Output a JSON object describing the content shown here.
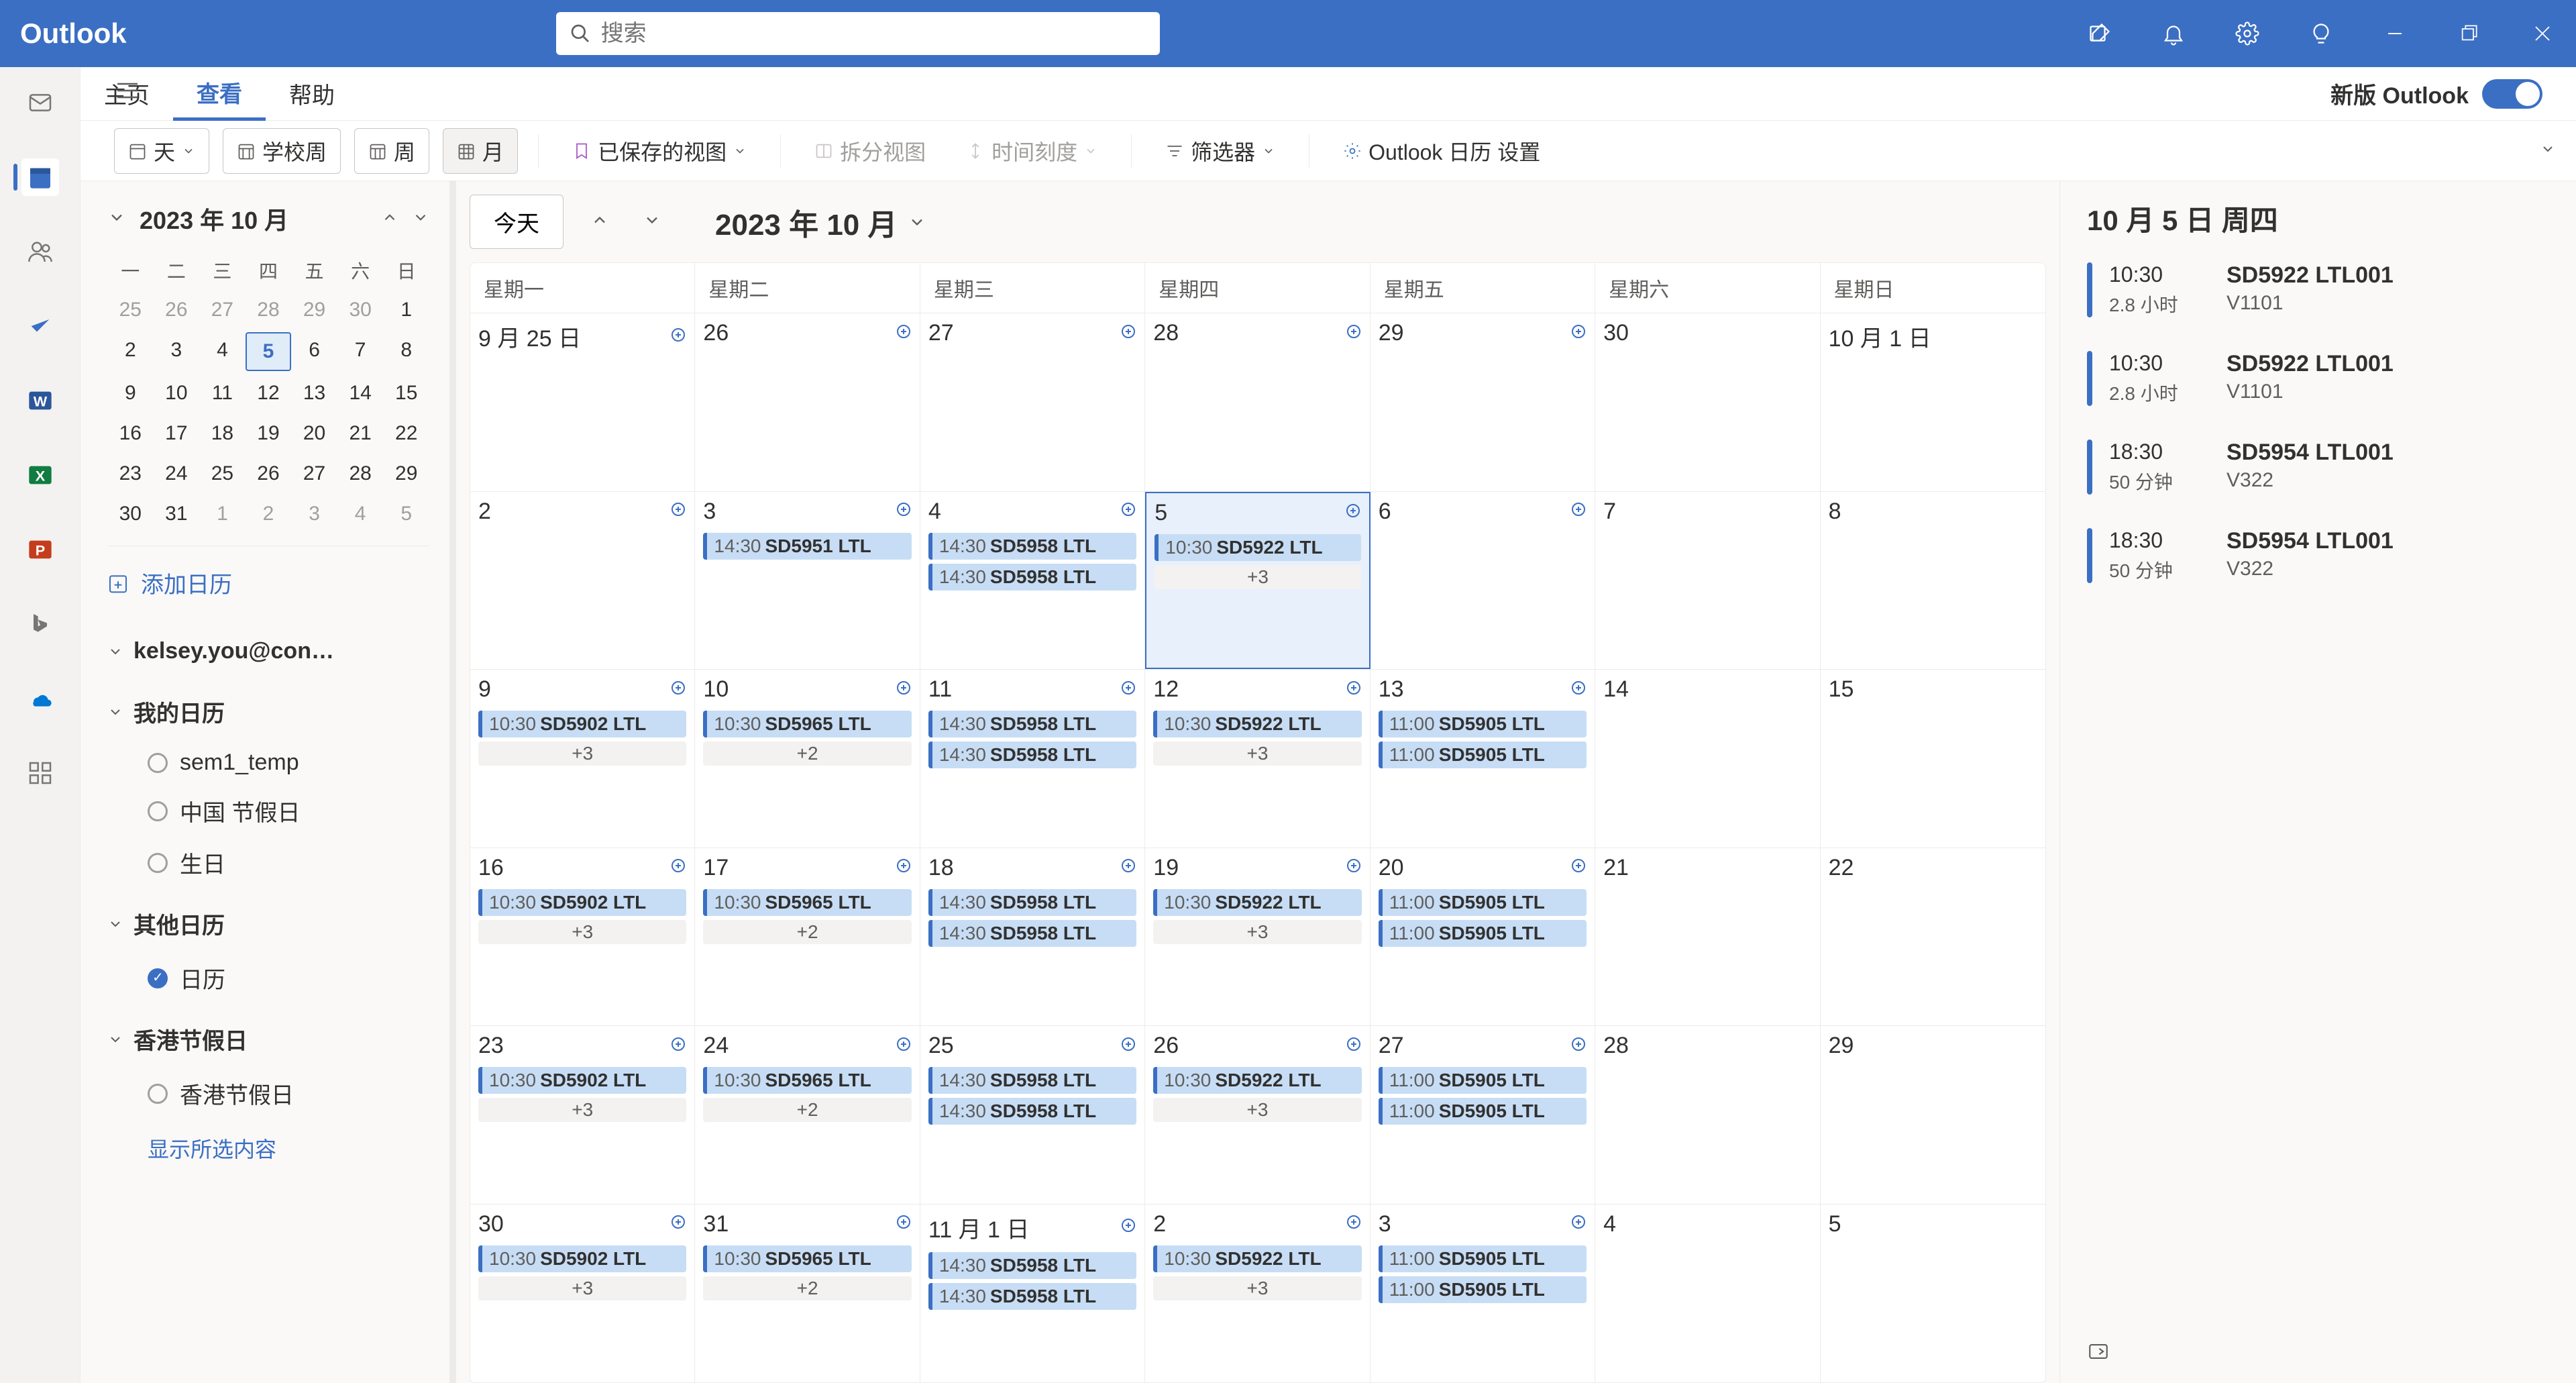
{
  "app": {
    "name": "Outlook"
  },
  "search": {
    "placeholder": "搜索"
  },
  "tabs": {
    "home": "主页",
    "view": "查看",
    "help": "帮助",
    "new_outlook": "新版 Outlook"
  },
  "ribbon": {
    "day": "天",
    "school_week": "学校周",
    "week": "周",
    "month": "月",
    "saved_views": "已保存的视图",
    "split_view": "拆分视图",
    "time_scale": "时间刻度",
    "filter": "筛选器",
    "settings": "Outlook 日历 设置"
  },
  "mini": {
    "label": "2023 年 10 月",
    "dow": [
      "一",
      "二",
      "三",
      "四",
      "五",
      "六",
      "日"
    ],
    "rows": [
      [
        {
          "d": "25",
          "o": true
        },
        {
          "d": "26",
          "o": true
        },
        {
          "d": "27",
          "o": true
        },
        {
          "d": "28",
          "o": true
        },
        {
          "d": "29",
          "o": true
        },
        {
          "d": "30",
          "o": true
        },
        {
          "d": "1"
        }
      ],
      [
        {
          "d": "2"
        },
        {
          "d": "3"
        },
        {
          "d": "4"
        },
        {
          "d": "5",
          "today": true
        },
        {
          "d": "6"
        },
        {
          "d": "7"
        },
        {
          "d": "8"
        }
      ],
      [
        {
          "d": "9"
        },
        {
          "d": "10"
        },
        {
          "d": "11"
        },
        {
          "d": "12"
        },
        {
          "d": "13"
        },
        {
          "d": "14"
        },
        {
          "d": "15"
        }
      ],
      [
        {
          "d": "16"
        },
        {
          "d": "17"
        },
        {
          "d": "18"
        },
        {
          "d": "19"
        },
        {
          "d": "20"
        },
        {
          "d": "21"
        },
        {
          "d": "22"
        }
      ],
      [
        {
          "d": "23"
        },
        {
          "d": "24"
        },
        {
          "d": "25"
        },
        {
          "d": "26"
        },
        {
          "d": "27"
        },
        {
          "d": "28"
        },
        {
          "d": "29"
        }
      ],
      [
        {
          "d": "30"
        },
        {
          "d": "31"
        },
        {
          "d": "1",
          "o": true
        },
        {
          "d": "2",
          "o": true
        },
        {
          "d": "3",
          "o": true
        },
        {
          "d": "4",
          "o": true
        },
        {
          "d": "5",
          "o": true
        }
      ]
    ]
  },
  "sidebar": {
    "add_calendar": "添加日历",
    "account": "kelsey.you@con…",
    "groups": [
      {
        "name": "我的日历",
        "items": [
          {
            "label": "sem1_temp",
            "on": false
          },
          {
            "label": "中国 节假日",
            "on": false
          },
          {
            "label": "生日",
            "on": false
          }
        ]
      },
      {
        "name": "其他日历",
        "items": [
          {
            "label": "日历",
            "on": true
          }
        ]
      },
      {
        "name": "香港节假日",
        "items": [
          {
            "label": "香港节假日",
            "on": false
          }
        ]
      }
    ],
    "show_selected": "显示所选内容"
  },
  "toolbar": {
    "today": "今天",
    "month_label": "2023 年 10 月"
  },
  "dow_full": [
    "星期一",
    "星期二",
    "星期三",
    "星期四",
    "星期五",
    "星期六",
    "星期日"
  ],
  "weeks": [
    [
      {
        "num": "9 月 25 日",
        "add": true,
        "events": []
      },
      {
        "num": "26",
        "add": true,
        "events": []
      },
      {
        "num": "27",
        "add": true,
        "events": []
      },
      {
        "num": "28",
        "add": true,
        "events": []
      },
      {
        "num": "29",
        "add": true,
        "events": []
      },
      {
        "num": "30",
        "events": []
      },
      {
        "num": "10 月 1 日",
        "events": []
      }
    ],
    [
      {
        "num": "2",
        "add": true,
        "events": []
      },
      {
        "num": "3",
        "add": true,
        "events": [
          {
            "t": "14:30",
            "txt": "SD5951 LTL"
          }
        ]
      },
      {
        "num": "4",
        "add": true,
        "events": [
          {
            "t": "14:30",
            "txt": "SD5958 LTL"
          },
          {
            "t": "14:30",
            "txt": "SD5958 LTL"
          }
        ]
      },
      {
        "num": "5",
        "add": true,
        "today": true,
        "events": [
          {
            "t": "10:30",
            "txt": "SD5922 LTL"
          }
        ],
        "more": "+3"
      },
      {
        "num": "6",
        "add": true,
        "events": []
      },
      {
        "num": "7",
        "events": []
      },
      {
        "num": "8",
        "events": []
      }
    ],
    [
      {
        "num": "9",
        "add": true,
        "events": [
          {
            "t": "10:30",
            "txt": "SD5902 LTL"
          }
        ],
        "more": "+3"
      },
      {
        "num": "10",
        "add": true,
        "events": [
          {
            "t": "10:30",
            "txt": "SD5965 LTL"
          }
        ],
        "more": "+2"
      },
      {
        "num": "11",
        "add": true,
        "events": [
          {
            "t": "14:30",
            "txt": "SD5958 LTL"
          },
          {
            "t": "14:30",
            "txt": "SD5958 LTL"
          }
        ]
      },
      {
        "num": "12",
        "add": true,
        "events": [
          {
            "t": "10:30",
            "txt": "SD5922 LTL"
          }
        ],
        "more": "+3"
      },
      {
        "num": "13",
        "add": true,
        "events": [
          {
            "t": "11:00",
            "txt": "SD5905 LTL"
          },
          {
            "t": "11:00",
            "txt": "SD5905 LTL"
          }
        ]
      },
      {
        "num": "14",
        "events": []
      },
      {
        "num": "15",
        "events": []
      }
    ],
    [
      {
        "num": "16",
        "add": true,
        "events": [
          {
            "t": "10:30",
            "txt": "SD5902 LTL"
          }
        ],
        "more": "+3"
      },
      {
        "num": "17",
        "add": true,
        "events": [
          {
            "t": "10:30",
            "txt": "SD5965 LTL"
          }
        ],
        "more": "+2"
      },
      {
        "num": "18",
        "add": true,
        "events": [
          {
            "t": "14:30",
            "txt": "SD5958 LTL"
          },
          {
            "t": "14:30",
            "txt": "SD5958 LTL"
          }
        ]
      },
      {
        "num": "19",
        "add": true,
        "events": [
          {
            "t": "10:30",
            "txt": "SD5922 LTL"
          }
        ],
        "more": "+3"
      },
      {
        "num": "20",
        "add": true,
        "events": [
          {
            "t": "11:00",
            "txt": "SD5905 LTL"
          },
          {
            "t": "11:00",
            "txt": "SD5905 LTL"
          }
        ]
      },
      {
        "num": "21",
        "events": []
      },
      {
        "num": "22",
        "events": []
      }
    ],
    [
      {
        "num": "23",
        "add": true,
        "events": [
          {
            "t": "10:30",
            "txt": "SD5902 LTL"
          }
        ],
        "more": "+3"
      },
      {
        "num": "24",
        "add": true,
        "events": [
          {
            "t": "10:30",
            "txt": "SD5965 LTL"
          }
        ],
        "more": "+2"
      },
      {
        "num": "25",
        "add": true,
        "events": [
          {
            "t": "14:30",
            "txt": "SD5958 LTL"
          },
          {
            "t": "14:30",
            "txt": "SD5958 LTL"
          }
        ]
      },
      {
        "num": "26",
        "add": true,
        "events": [
          {
            "t": "10:30",
            "txt": "SD5922 LTL"
          }
        ],
        "more": "+3"
      },
      {
        "num": "27",
        "add": true,
        "events": [
          {
            "t": "11:00",
            "txt": "SD5905 LTL"
          },
          {
            "t": "11:00",
            "txt": "SD5905 LTL"
          }
        ]
      },
      {
        "num": "28",
        "events": []
      },
      {
        "num": "29",
        "events": []
      }
    ],
    [
      {
        "num": "30",
        "add": true,
        "events": [
          {
            "t": "10:30",
            "txt": "SD5902 LTL"
          }
        ],
        "more": "+3"
      },
      {
        "num": "31",
        "add": true,
        "events": [
          {
            "t": "10:30",
            "txt": "SD5965 LTL"
          }
        ],
        "more": "+2"
      },
      {
        "num": "11 月 1 日",
        "add": true,
        "events": [
          {
            "t": "14:30",
            "txt": "SD5958 LTL"
          },
          {
            "t": "14:30",
            "txt": "SD5958 LTL"
          }
        ]
      },
      {
        "num": "2",
        "add": true,
        "events": [
          {
            "t": "10:30",
            "txt": "SD5922 LTL"
          }
        ],
        "more": "+3"
      },
      {
        "num": "3",
        "add": true,
        "events": [
          {
            "t": "11:00",
            "txt": "SD5905 LTL"
          },
          {
            "t": "11:00",
            "txt": "SD5905 LTL"
          }
        ]
      },
      {
        "num": "4",
        "events": []
      },
      {
        "num": "5",
        "events": []
      }
    ]
  ],
  "agenda": {
    "title": "10 月 5 日 周四",
    "items": [
      {
        "time": "10:30",
        "dur": "2.8 小时",
        "title": "SD5922 LTL001",
        "loc": "V1101"
      },
      {
        "time": "10:30",
        "dur": "2.8 小时",
        "title": "SD5922 LTL001",
        "loc": "V1101"
      },
      {
        "time": "18:30",
        "dur": "50 分钟",
        "title": "SD5954 LTL001",
        "loc": "V322"
      },
      {
        "time": "18:30",
        "dur": "50 分钟",
        "title": "SD5954 LTL001",
        "loc": "V322"
      }
    ]
  }
}
